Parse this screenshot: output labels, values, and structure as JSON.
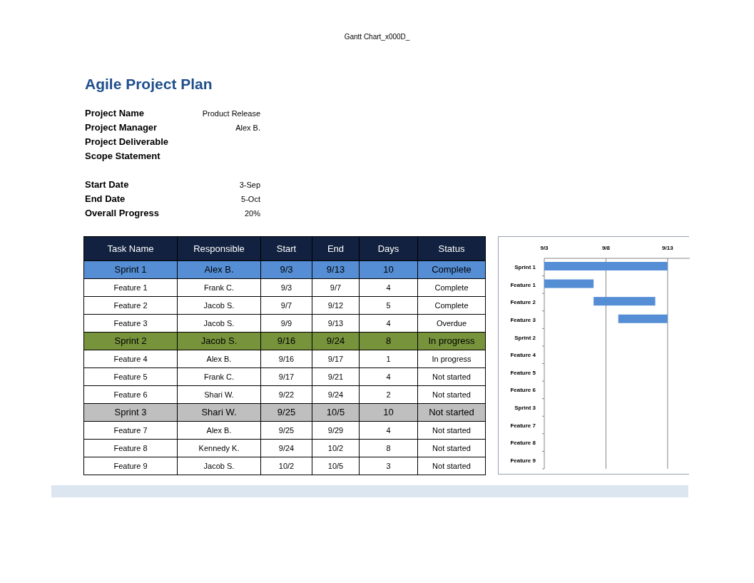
{
  "page_header": "Gantt Chart_x000D_",
  "title": "Agile Project Plan",
  "project_info": [
    {
      "label": "Project Name",
      "value": "Product Release"
    },
    {
      "label": "Project Manager",
      "value": "Alex B."
    },
    {
      "label": "Project Deliverable"
    },
    {
      "label": "Scope Statement"
    }
  ],
  "schedule_info": [
    {
      "label": "Start Date",
      "value": "3-Sep"
    },
    {
      "label": "End Date",
      "value": "5-Oct"
    },
    {
      "label": "Overall Progress",
      "value": "20%"
    }
  ],
  "table": {
    "columns": [
      "Task Name",
      "Responsible",
      "Start",
      "End",
      "Days",
      "Status"
    ],
    "rows": [
      {
        "kind": "sprint",
        "color": "#558ed5",
        "cells": [
          "Sprint 1",
          "Alex B.",
          "9/3",
          "9/13",
          "10",
          "Complete"
        ]
      },
      {
        "kind": "feature",
        "cells": [
          "Feature 1",
          "Frank C.",
          "9/3",
          "9/7",
          "4",
          "Complete"
        ]
      },
      {
        "kind": "feature",
        "cells": [
          "Feature 2",
          "Jacob S.",
          "9/7",
          "9/12",
          "5",
          "Complete"
        ]
      },
      {
        "kind": "feature",
        "cells": [
          "Feature 3",
          "Jacob S.",
          "9/9",
          "9/13",
          "4",
          "Overdue"
        ]
      },
      {
        "kind": "sprint",
        "color": "#77933c",
        "cells": [
          "Sprint 2",
          "Jacob S.",
          "9/16",
          "9/24",
          "8",
          "In progress"
        ]
      },
      {
        "kind": "feature",
        "cells": [
          "Feature 4",
          "Alex B.",
          "9/16",
          "9/17",
          "1",
          "In progress"
        ]
      },
      {
        "kind": "feature",
        "cells": [
          "Feature 5",
          "Frank C.",
          "9/17",
          "9/21",
          "4",
          "Not started"
        ]
      },
      {
        "kind": "feature",
        "cells": [
          "Feature 6",
          "Shari W.",
          "9/22",
          "9/24",
          "2",
          "Not started"
        ]
      },
      {
        "kind": "sprint",
        "color": "#bfbfbf",
        "cells": [
          "Sprint 3",
          "Shari W.",
          "9/25",
          "10/5",
          "10",
          "Not started"
        ]
      },
      {
        "kind": "feature",
        "cells": [
          "Feature 7",
          "Alex B.",
          "9/25",
          "9/29",
          "4",
          "Not started"
        ]
      },
      {
        "kind": "feature",
        "cells": [
          "Feature 8",
          "Kennedy K.",
          "9/24",
          "10/2",
          "8",
          "Not started"
        ]
      },
      {
        "kind": "feature",
        "cells": [
          "Feature 9",
          "Jacob S.",
          "10/2",
          "10/5",
          "3",
          "Not started"
        ]
      }
    ]
  },
  "gantt": {
    "date_labels": [
      "9/3",
      "9/8",
      "9/13"
    ],
    "task_labels": [
      "Sprint 1",
      "Feature 1",
      "Feature 2",
      "Feature 3",
      "Sprint 2",
      "Feature 4",
      "Feature 5",
      "Feature 6",
      "Sprint 3",
      "Feature 7",
      "Feature 8",
      "Feature 9"
    ]
  }
}
